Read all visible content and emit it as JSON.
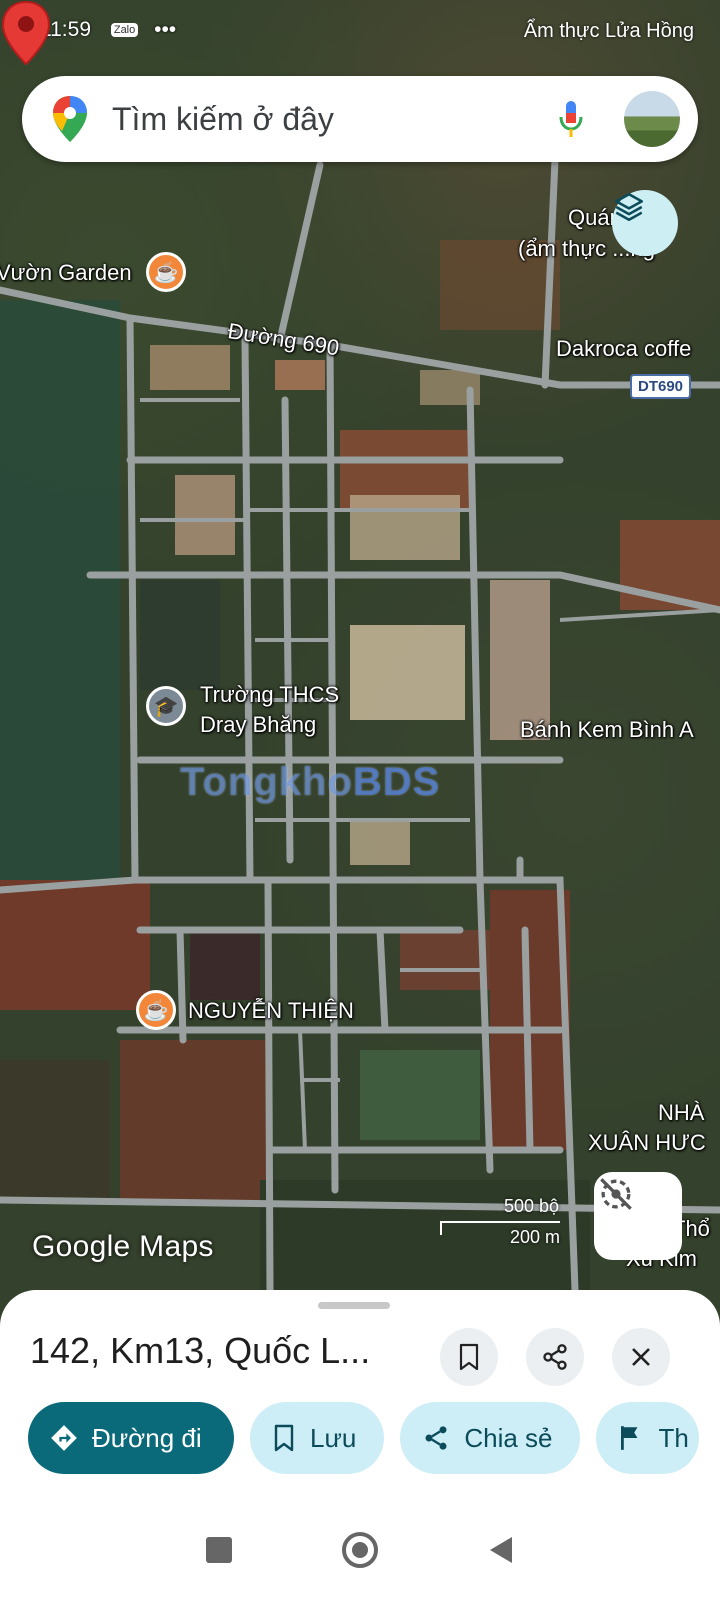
{
  "status_bar": {
    "time": "11:59",
    "app_badge": "Zalo",
    "more": "•••",
    "overlay_text": "Ẩm thực Lửa Hồng"
  },
  "search": {
    "placeholder": "Tìm kiếm ở đây"
  },
  "map": {
    "labels": {
      "garden": "Vườn Garden",
      "road": "Đường 690",
      "quan_line1": "Quán ...ng",
      "quan_line2": "(ẩm thực ...ng",
      "dakroca": "Dakroca coffe",
      "route_shield": "DT690",
      "school_line1": "Trường THCS",
      "school_line2": "Dray Bhăng",
      "banh_kem": "Bánh Kem Bình A",
      "nguyen_thien": "NGUYỄN THIỆN",
      "nha_line1": "NHÀ",
      "nha_line2": "XUÂN HƯC",
      "tho_line1": "Thổ",
      "tho_line2": "Xu Kim"
    },
    "watermark": {
      "part1": "Tongkho",
      "part2": "BDS"
    },
    "scale": {
      "imperial": "500 bộ",
      "metric": "200 m"
    },
    "logo": "Google Maps"
  },
  "sheet": {
    "title": "142, Km13, Quốc L...",
    "actions": [
      {
        "label": "Đường đi",
        "icon": "directions-icon"
      },
      {
        "label": "Lưu",
        "icon": "bookmark-icon"
      },
      {
        "label": "Chia sẻ",
        "icon": "share-icon"
      },
      {
        "label": "Th",
        "icon": "flag-icon"
      }
    ]
  },
  "colors": {
    "primary": "#0b6a7a",
    "chip": "#cdeef6",
    "pin": "#e53935",
    "cafe": "#f2873a"
  }
}
